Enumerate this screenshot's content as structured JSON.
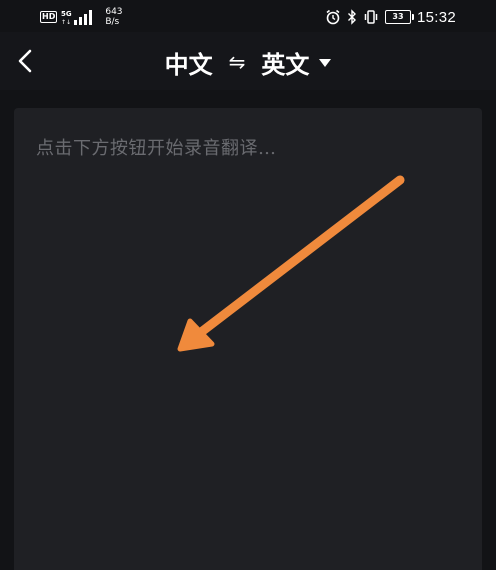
{
  "status_bar": {
    "hd": "HD",
    "signal_label": "5G",
    "net_speed_value": "643",
    "net_speed_unit": "B/s",
    "battery": "33",
    "time": "15:32"
  },
  "header": {
    "source_lang": "中文",
    "swap_symbol": "⇋",
    "target_lang": "英文"
  },
  "main": {
    "placeholder": "点击下方按钮开始录音翻译…"
  },
  "colors": {
    "background": "#121316",
    "card": "#1f2024",
    "placeholder": "#6a6b70",
    "arrow": "#f08a3c"
  }
}
